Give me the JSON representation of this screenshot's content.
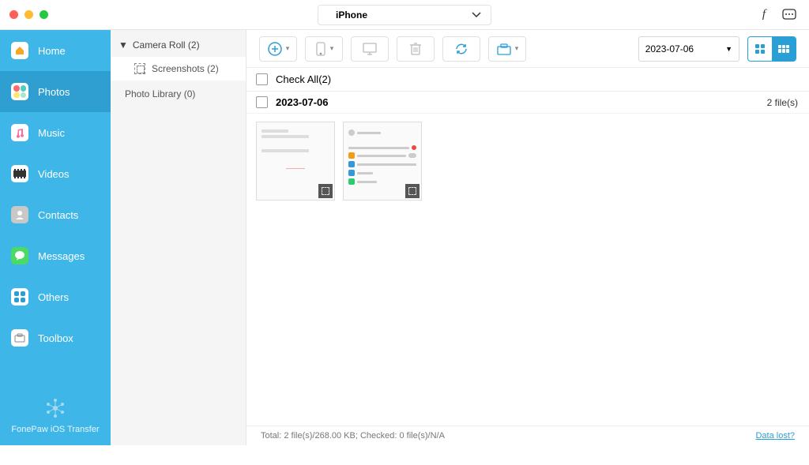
{
  "device": {
    "name": "iPhone"
  },
  "sidebar": {
    "items": [
      {
        "label": "Home"
      },
      {
        "label": "Photos"
      },
      {
        "label": "Music"
      },
      {
        "label": "Videos"
      },
      {
        "label": "Contacts"
      },
      {
        "label": "Messages"
      },
      {
        "label": "Others"
      },
      {
        "label": "Toolbox"
      }
    ],
    "footer": "FonePaw iOS Transfer"
  },
  "subnav": {
    "camera_roll": "Camera Roll (2)",
    "screenshots": "Screenshots (2)",
    "photo_library": "Photo Library (0)"
  },
  "toolbar": {
    "date_filter": "2023-07-06"
  },
  "content": {
    "check_all": "Check All(2)",
    "group_date": "2023-07-06",
    "group_count": "2 file(s)"
  },
  "status": {
    "text": "Total: 2 file(s)/268.00 KB; Checked: 0 file(s)/N/A",
    "link": "Data lost?"
  }
}
